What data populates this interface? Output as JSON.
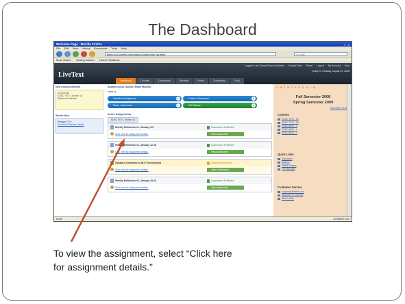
{
  "slide": {
    "title": "The Dashboard",
    "caption_line1": "To view the assignment, select “Click here",
    "caption_line2": "for assignment details.”",
    "arrow_color": "#c0502a"
  },
  "browser": {
    "window_title": "Welcome Page - Mozilla Firefox",
    "window_buttons": "_ □ ×",
    "menu": [
      "File",
      "Edit",
      "View",
      "History",
      "Bookmarks",
      "Tools",
      "Help"
    ],
    "url": "https://c1.livetext.com/misc/c1/welcome_student",
    "search_placeholder": "Google",
    "bookmarks": [
      "Most Visited",
      "Getting Started",
      "Latest Headlines"
    ],
    "status_left": "Done",
    "status_right": "c1.livetext.com"
  },
  "livetext": {
    "logo": "LiveText",
    "login_items": [
      "Logged in as Teresa Fisher (Student)",
      "Faculty View",
      "Travel",
      "Logout",
      "My Account",
      "Help"
    ],
    "date": "Today is: Tuesday, August 31, 2008",
    "tabs": [
      "Dashboard",
      "Courses",
      "Documents",
      "Reviews",
      "Forms",
      "Community",
      "Tools"
    ],
    "active_tab": "Dashboard",
    "left": {
      "announcements_heading": "New Announcements",
      "announcement_date": "09-15-2008",
      "announcement_text": "EDEC 7970 - Section 16",
      "announcement_note": "Syllabus Deadlines",
      "whats_new_heading": "What's New",
      "whats_new_text": "Release 7.5.0",
      "whats_new_more": "See New Features Details"
    },
    "middle": {
      "quick_heading": "Student Quick Guides (Flash Movies)",
      "how_to": "How to:",
      "quick_buttons": [
        "Submit an Assignment",
        "Create a Document",
        "Share a Document",
        "Get Started"
      ],
      "active_heading": "Active Assignments",
      "subtab": "EDEC 7970 - Section 16",
      "assignments": [
        {
          "title": "Weekly Reflection #1, January 5-9",
          "detail": "Click here for assignment details.",
          "status": "Assessment Published",
          "button": "View Assessment"
        },
        {
          "title": "Weekly Reflection #2, January 12-16",
          "detail": "Click here for assignment details.",
          "status": "Assessment Published",
          "button": "View Assessment"
        },
        {
          "title": "Syllabus Submitted to BOT Receptionist",
          "detail": "Click here for assignment details.",
          "status": "Awaiting Assessment",
          "button": "Latest Submission"
        },
        {
          "title": "Weekly Reflection #3, January 19-23",
          "detail": "Click here for assignment details.",
          "status": "Assessment Published",
          "button": "View Assessment"
        }
      ]
    },
    "right": {
      "calendar_strip": "S M T W T F S S M T W",
      "semester1": "Fall Semester 2008",
      "semester2": "Spring Semester 2009",
      "view_terms": "View Other Terms",
      "courses_heading": "Courses",
      "courses": [
        "EDEC 7970 - 16",
        "EDEC 7970 - 16",
        "EDEC 8000 - 1",
        "EDEC 8000 - 1",
        "EDEC 8000 - 2"
      ],
      "quick_links_heading": "Quick Links",
      "quick_links": [
        "Standards",
        "Rubrics",
        "Online Papers",
        "File Manager"
      ],
      "customer_service_heading": "Customer Service",
      "customer_service": [
        "support@livetext.com",
        "Welcome to LiveText",
        "What's New"
      ]
    }
  }
}
